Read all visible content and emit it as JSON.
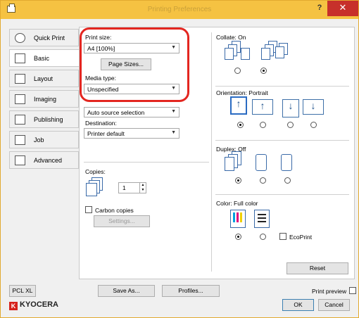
{
  "window": {
    "title": "Printing Preferences",
    "help": "?",
    "close": "✕"
  },
  "tabs": [
    {
      "label": "Quick Print",
      "icon": "quick-print-icon"
    },
    {
      "label": "Basic",
      "icon": "basic-icon"
    },
    {
      "label": "Layout",
      "icon": "layout-icon"
    },
    {
      "label": "Imaging",
      "icon": "imaging-icon"
    },
    {
      "label": "Publishing",
      "icon": "publishing-icon"
    },
    {
      "label": "Job",
      "icon": "job-icon"
    },
    {
      "label": "Advanced",
      "icon": "advanced-icon"
    }
  ],
  "basic": {
    "print_size_label": "Print size:",
    "print_size_value": "A4 [100%]",
    "page_sizes_button": "Page Sizes...",
    "media_type_label": "Media type:",
    "media_type_value": "Unspecified",
    "source_value": "Auto source selection",
    "destination_label": "Destination:",
    "destination_value": "Printer default",
    "copies_label": "Copies:",
    "copies_value": "1",
    "carbon_copies_label": "Carbon copies",
    "settings_button": "Settings..."
  },
  "right": {
    "collate_label": "Collate: On",
    "orientation_label": "Orientation: Portrait",
    "duplex_label": "Duplex: Off",
    "color_label": "Color: Full color",
    "ecoprint_label": "EcoPrint",
    "reset_button": "Reset"
  },
  "footer": {
    "pcl_button": "PCL XL",
    "save_as_button": "Save As...",
    "profiles_button": "Profiles...",
    "print_preview_label": "Print preview",
    "brand": "KYOCERA",
    "ok_button": "OK",
    "cancel_button": "Cancel"
  },
  "colors": {
    "titlebar": "#f5c242",
    "highlight": "#e32620",
    "close": "#c7302b"
  }
}
